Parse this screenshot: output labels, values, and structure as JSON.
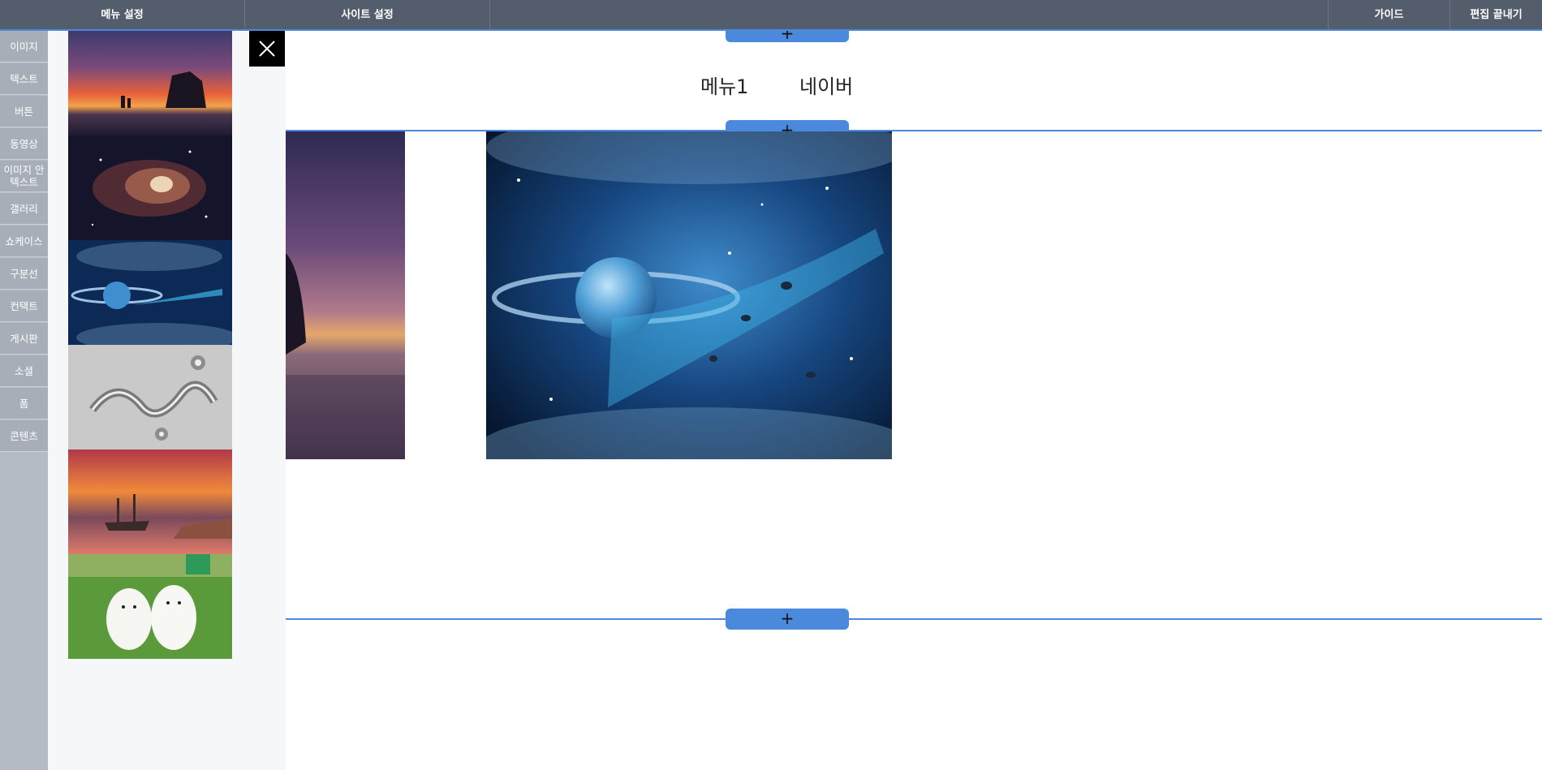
{
  "topbar": {
    "menu_settings": "메뉴 설정",
    "site_settings": "사이트 설정",
    "guide": "가이드",
    "end_edit": "편집 끝내기"
  },
  "leftnav": {
    "items": [
      "이미지",
      "텍스트",
      "버튼",
      "동영상",
      "이미지 안\n텍스트",
      "갤러리",
      "쇼케이스",
      "구분선",
      "컨택트",
      "게시판",
      "소셜",
      "폼",
      "콘텐츠"
    ]
  },
  "image_panel": {
    "thumbnails": [
      "sunset-sea-stack",
      "orion-nebula",
      "saturn-space",
      "metallic-calligraphy",
      "shipwreck-sunset",
      "white-puppies"
    ]
  },
  "canvas": {
    "add_symbol": "+",
    "menu_items": [
      "메뉴1",
      "네이버"
    ]
  },
  "colors": {
    "topbar_bg": "#545d6b",
    "accent": "#4a89dc",
    "nav_bg": "#a8aeb8",
    "panel_bg": "#f6f7f9"
  }
}
